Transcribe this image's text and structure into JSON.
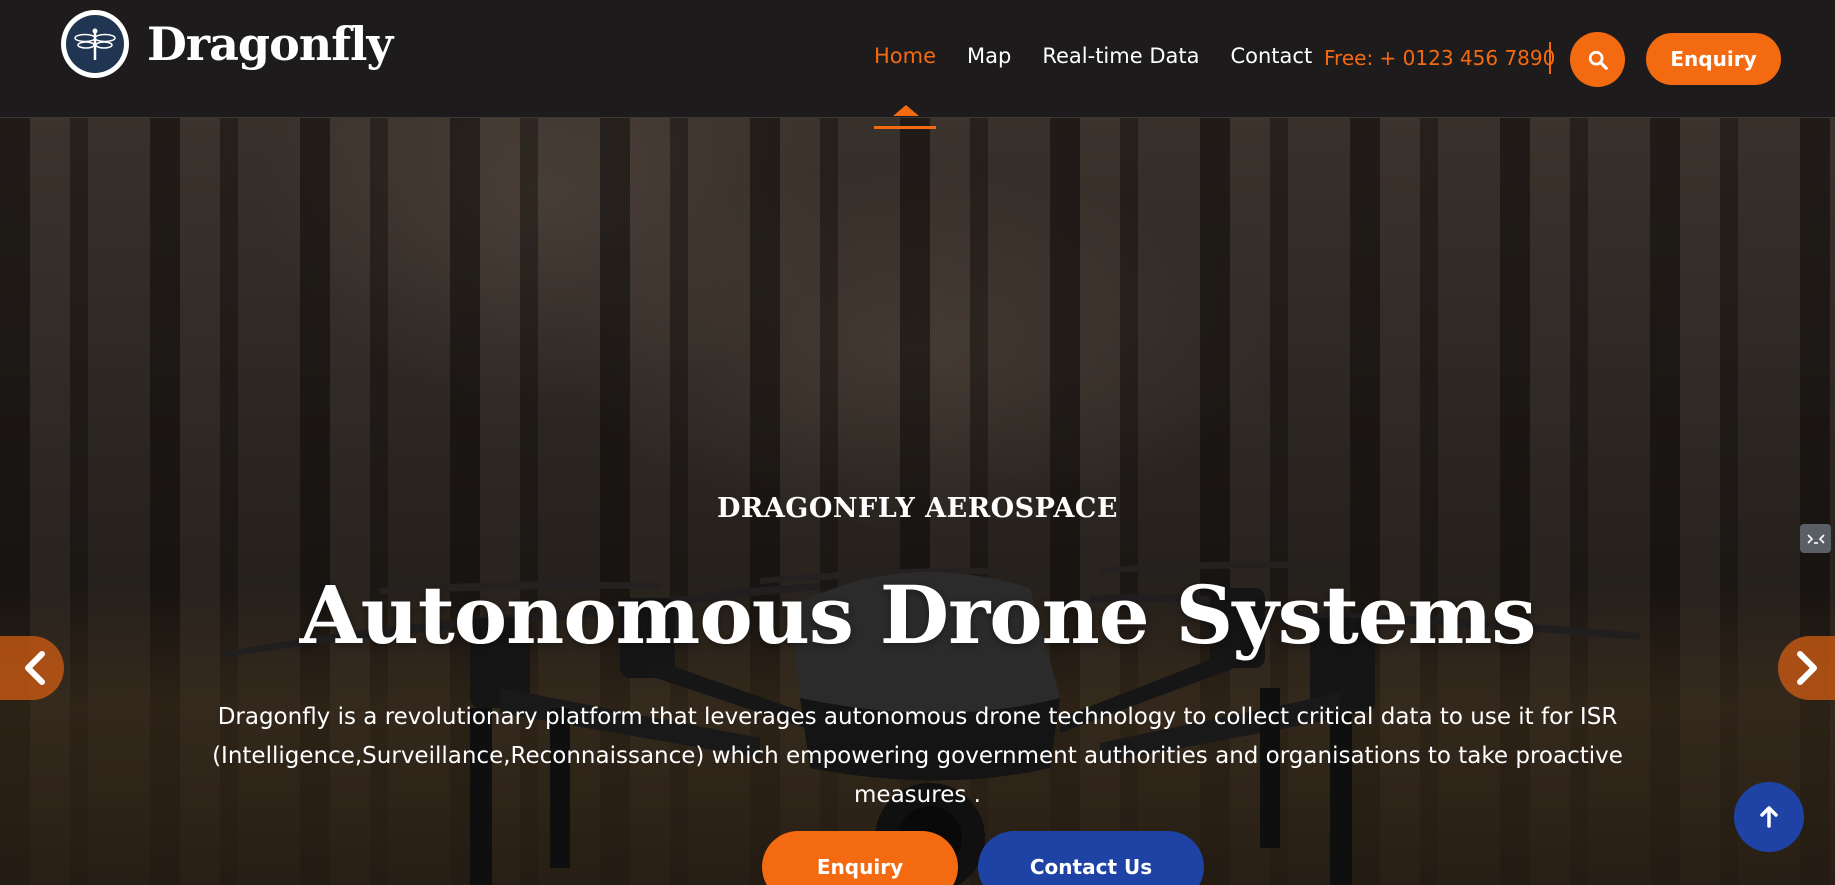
{
  "brand": {
    "name": "Dragonfly"
  },
  "nav": {
    "items": [
      {
        "label": "Home",
        "active": true
      },
      {
        "label": "Map",
        "active": false
      },
      {
        "label": "Real-time Data",
        "active": false
      },
      {
        "label": "Contact",
        "active": false
      }
    ],
    "phone": "Free: + 0123 456 7890",
    "enquiry_label": "Enquiry",
    "search_icon": "search-icon"
  },
  "hero": {
    "eyebrow": "DRAGONFLY AEROSPACE",
    "title": "Autonomous Drone Systems",
    "description_line1": "Dragonfly is a revolutionary platform that leverages autonomous drone technology to collect critical data to use it for ISR",
    "description_line2": "(Intelligence,Surveillance,Reconnaissance) which empowering government authorities and organisations to take proactive measures .",
    "primary_button": "Enquiry",
    "secondary_button": "Contact Us",
    "prev_icon": "chevron-left-icon",
    "next_icon": "chevron-right-icon",
    "scroll_top_icon": "arrow-up-icon"
  },
  "colors": {
    "accent": "#f36a10",
    "secondary": "#1e43a5",
    "header_bg": "#1d1b1c"
  }
}
